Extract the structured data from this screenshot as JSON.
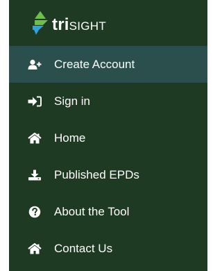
{
  "brand": {
    "name_part1": "tri",
    "name_part2": "SIGHT"
  },
  "colors": {
    "sidebar_bg": "#1f3a22",
    "active_bg": "#2a4f4c",
    "text": "#ffffff",
    "logo_green": "#6cc04a",
    "logo_blue": "#2ea3dc"
  },
  "nav": {
    "items": [
      {
        "label": "Create Account",
        "icon": "user-plus-icon",
        "active": true
      },
      {
        "label": "Sign in",
        "icon": "sign-in-icon",
        "active": false
      },
      {
        "label": "Home",
        "icon": "home-icon",
        "active": false
      },
      {
        "label": "Published EPDs",
        "icon": "download-icon",
        "active": false
      },
      {
        "label": "About the Tool",
        "icon": "question-circle-icon",
        "active": false
      },
      {
        "label": "Contact Us",
        "icon": "home-icon",
        "active": false
      }
    ]
  }
}
